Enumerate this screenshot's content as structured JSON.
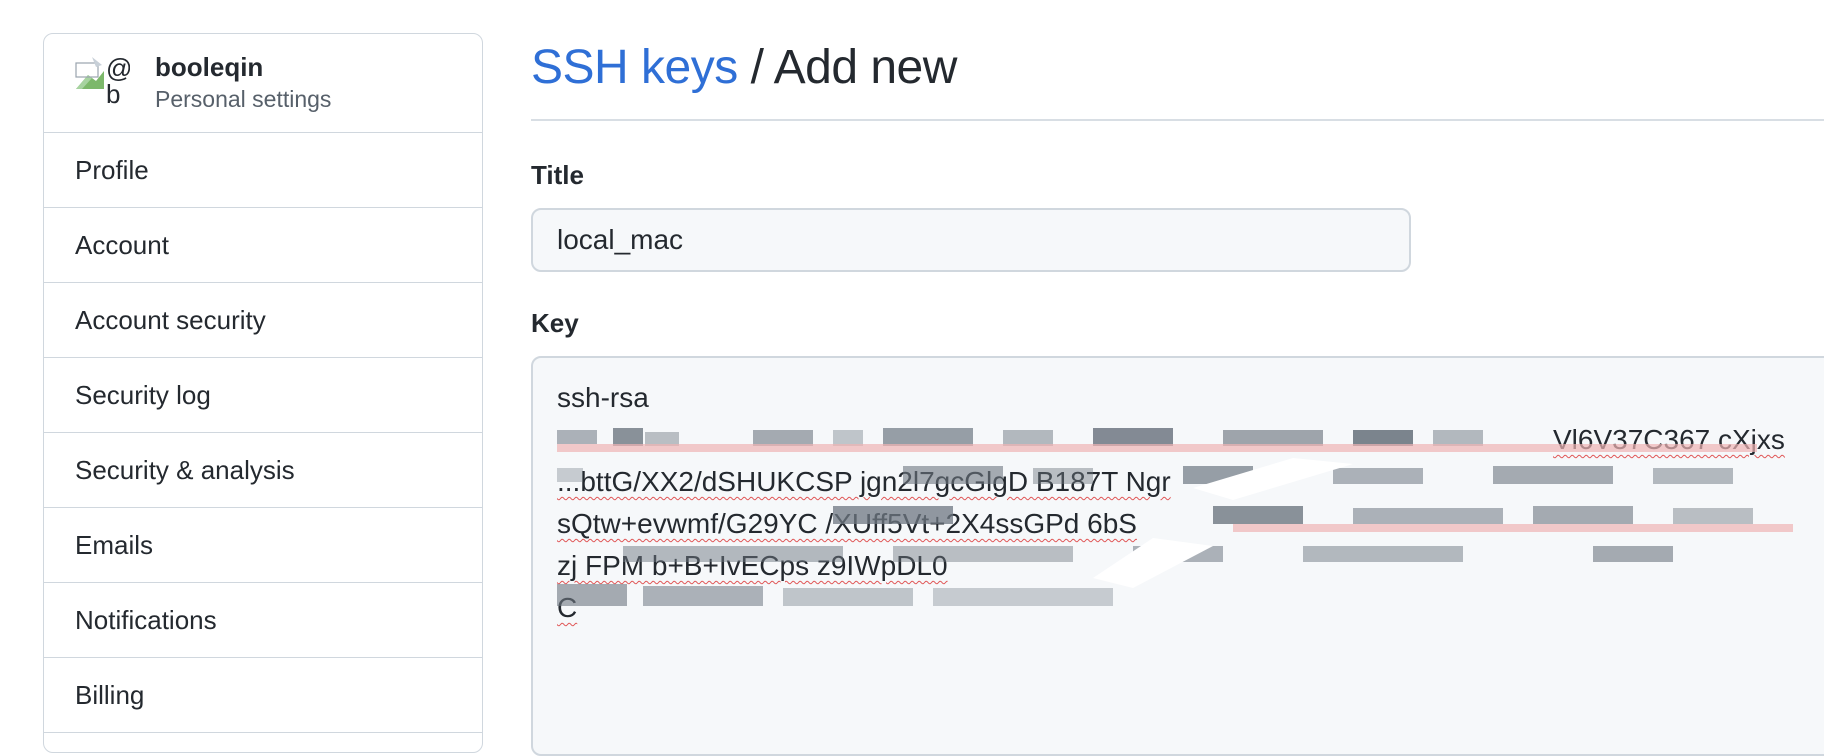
{
  "sidebar": {
    "user": {
      "name": "booleqin",
      "subtitle": "Personal settings"
    },
    "items": [
      {
        "label": "Profile"
      },
      {
        "label": "Account"
      },
      {
        "label": "Account security"
      },
      {
        "label": "Security log"
      },
      {
        "label": "Security & analysis"
      },
      {
        "label": "Emails"
      },
      {
        "label": "Notifications"
      },
      {
        "label": "Billing"
      }
    ]
  },
  "header": {
    "breadcrumb_link": "SSH keys",
    "separator": "/",
    "current": "Add new"
  },
  "form": {
    "title_label": "Title",
    "title_value": "local_mac",
    "key_label": "Key",
    "key_lines": [
      "ssh-rsa",
      "Vl6V37C367 cXjxs",
      "...bttG/XX2/dSHUKCSP  jgn2l7gcGlgD  B187T  Ngr",
      "sQtw+evwmf/G29YC  /XUff5Vt+2X4ssGPd  6bS",
      "zj  FPM  b+B+IvECps  z9IWpDL0",
      "C"
    ]
  },
  "colors": {
    "link": "#2f6fd6",
    "border": "#d0d7de",
    "input_bg": "#f6f8fa",
    "spell_underline": "#e05555"
  },
  "icons": {
    "avatar": "broken-image-avatar"
  }
}
